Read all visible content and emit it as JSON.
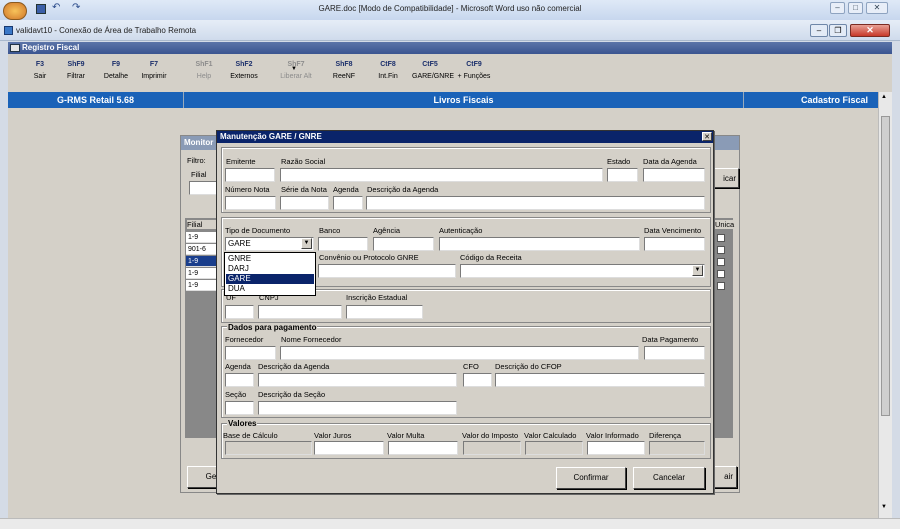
{
  "word": {
    "title": "GARE.doc [Modo de Compatibilidade] - Microsoft Word uso não comercial",
    "quick_access": [
      "save-icon",
      "undo-icon",
      "redo-icon"
    ]
  },
  "rdp": {
    "title": "validavt10 - Conexão de Área de Trabalho Remota"
  },
  "app": {
    "window_title": "Registro Fiscal",
    "toolbar": [
      {
        "key": "F3",
        "label": "Sair",
        "enabled": true
      },
      {
        "key": "ShF9",
        "label": "Filtrar",
        "enabled": true
      },
      {
        "key": "F9",
        "label": "Detalhe",
        "enabled": true
      },
      {
        "key": "F7",
        "label": "Imprimir",
        "enabled": true
      },
      {
        "key": "ShF1",
        "label": "Help",
        "enabled": false
      },
      {
        "key": "ShF2",
        "label": "Externos",
        "enabled": true
      },
      {
        "key": "ShF7",
        "label": "Liberar Alt",
        "enabled": false
      },
      {
        "key": "ShF8",
        "label": "ReeNF",
        "enabled": true
      },
      {
        "key": "CtF8",
        "label": "Int.Fin",
        "enabled": true
      },
      {
        "key": "CtF5",
        "label": "GARE/GNRE",
        "enabled": true
      },
      {
        "key": "CtF9",
        "label": "+ Funções",
        "enabled": true
      }
    ],
    "bluebar": {
      "product": "G-RMS Retail 5.68",
      "module": "Livros Fiscais",
      "screen": "Cadastro Fiscal"
    }
  },
  "monitor": {
    "title": "Monitor",
    "filter_label": "Filtro:",
    "filial_label": "Filial",
    "grid_header": "Filial",
    "rows": [
      "1-9",
      "901-6",
      "1-9",
      "1-9",
      "1-9"
    ],
    "right_header": "Unica",
    "btn_left": "Ger",
    "btn_right": "air",
    "btn_top": "icar"
  },
  "dialog": {
    "title": "Manutenção GARE / GNRE",
    "labels": {
      "emitente": "Emitente",
      "razao_social": "Razão Social",
      "estado": "Estado",
      "data_agenda": "Data da Agenda",
      "numero_nota": "Número Nota",
      "serie_nota": "Série da Nota",
      "agenda": "Agenda",
      "descricao_agenda": "Descrição da Agenda",
      "tipo_documento": "Tipo de Documento",
      "banco": "Banco",
      "agencia": "Agência",
      "autenticacao": "Autenticação",
      "data_vencimento": "Data Vencimento",
      "convenio": "Convênio ou Protocolo GNRE",
      "codigo_receita": "Código da Receita",
      "uf": "UF",
      "cnpj": "CNPJ",
      "inscricao_estadual": "Inscrição Estadual",
      "dados_pagamento": "Dados para pagamento",
      "fornecedor": "Fornecedor",
      "nome_fornecedor": "Nome Fornecedor",
      "data_pagamento": "Data Pagamento",
      "agenda2": "Agenda",
      "descricao_agenda2": "Descrição da Agenda",
      "cfo": "CFO",
      "descricao_cfop": "Descrição do CFOP",
      "secao": "Seção",
      "descricao_secao": "Descrição da Seção",
      "valores": "Valores",
      "base_calculo": "Base de Cálculo",
      "valor_juros": "Valor Juros",
      "valor_multa": "Valor Multa",
      "valor_imposto": "Valor do Imposto",
      "valor_calculado": "Valor Calculado",
      "valor_informado": "Valor Informado",
      "diferenca": "Diferença"
    },
    "tipo_documento_value": "GARE",
    "tipo_documento_options": [
      "GNRE",
      "DARJ",
      "GARE",
      "DUA"
    ],
    "tipo_documento_selected": "GARE",
    "confirm_label": "Confirmar",
    "cancel_label": "Cancelar"
  }
}
